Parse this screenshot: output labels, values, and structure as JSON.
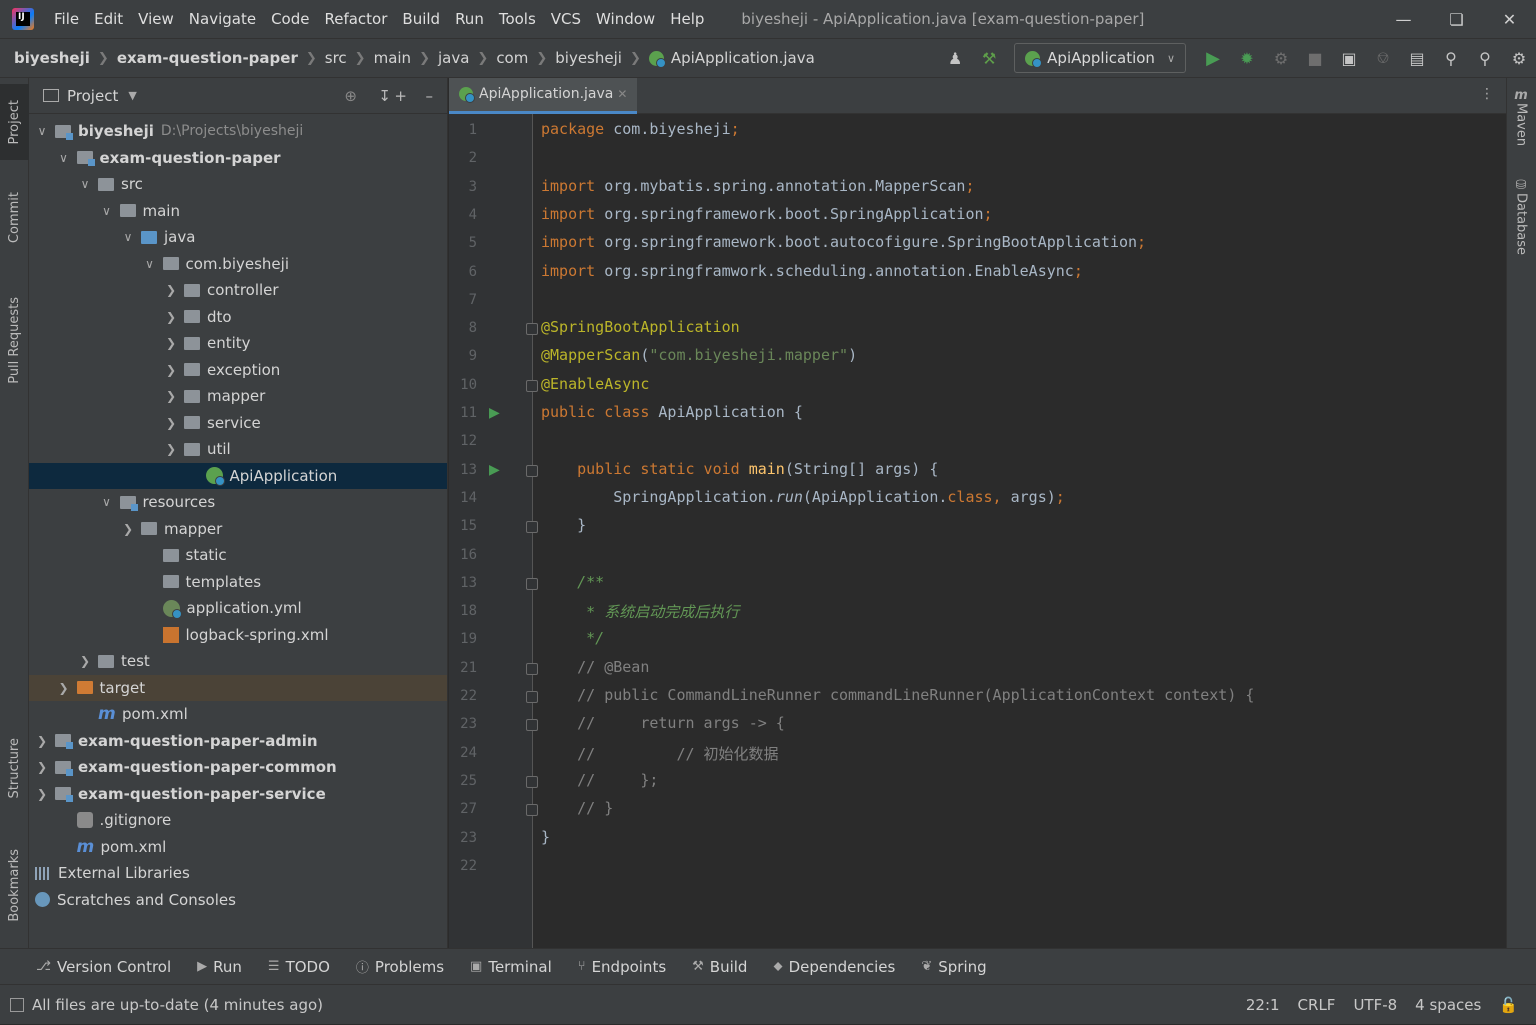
{
  "titlebar": {
    "menu": [
      "File",
      "Edit",
      "View",
      "Navigate",
      "Code",
      "Refactor",
      "Build",
      "Run",
      "Tools",
      "VCS",
      "Window",
      "Help"
    ],
    "window_title": "biyesheji - ApiApplication.java [exam-question-paper]"
  },
  "breadcrumb": [
    "biyesheji",
    "exam-question-paper",
    "src",
    "main",
    "java",
    "com",
    "biyesheji",
    "ApiApplication.java"
  ],
  "run_config": "ApiApplication",
  "left_stripe": [
    "Project",
    "Commit",
    "Pull Requests",
    "Structure",
    "Bookmarks"
  ],
  "right_stripe": [
    "Maven",
    "Database"
  ],
  "project": {
    "title": "Project",
    "root_path": "D:\\Projects\\biyesheji",
    "tree": [
      {
        "label": "biyesheji",
        "depth": 0,
        "icon": "module-folder",
        "chev": "down",
        "bold": true
      },
      {
        "label": "exam-question-paper",
        "depth": 1,
        "icon": "module-folder",
        "chev": "down",
        "bold": true
      },
      {
        "label": "src",
        "depth": 2,
        "icon": "folder",
        "chev": "down"
      },
      {
        "label": "main",
        "depth": 3,
        "icon": "folder",
        "chev": "down"
      },
      {
        "label": "java",
        "depth": 4,
        "icon": "source-folder",
        "chev": "down"
      },
      {
        "label": "com.biyesheji",
        "depth": 5,
        "icon": "package-folder",
        "chev": "down"
      },
      {
        "label": "controller",
        "depth": 6,
        "icon": "package-folder",
        "chev": "right"
      },
      {
        "label": "dto",
        "depth": 6,
        "icon": "package-folder",
        "chev": "right"
      },
      {
        "label": "entity",
        "depth": 6,
        "icon": "package-folder",
        "chev": "right"
      },
      {
        "label": "exception",
        "depth": 6,
        "icon": "package-folder",
        "chev": "right"
      },
      {
        "label": "mapper",
        "depth": 6,
        "icon": "package-folder",
        "chev": "right"
      },
      {
        "label": "service",
        "depth": 6,
        "icon": "package-folder",
        "chev": "right"
      },
      {
        "label": "util",
        "depth": 6,
        "icon": "package-folder",
        "chev": "right"
      },
      {
        "label": "ApiApplication",
        "depth": 7,
        "icon": "spring-class",
        "chev": "none",
        "selected": true
      },
      {
        "label": "resources",
        "depth": 3,
        "icon": "resources-folder",
        "chev": "down"
      },
      {
        "label": "mapper",
        "depth": 4,
        "icon": "folder",
        "chev": "right"
      },
      {
        "label": "static",
        "depth": 5,
        "icon": "folder",
        "chev": "none"
      },
      {
        "label": "templates",
        "depth": 5,
        "icon": "folder",
        "chev": "none"
      },
      {
        "label": "application.yml",
        "depth": 5,
        "icon": "yml-file",
        "chev": "none"
      },
      {
        "label": "logback-spring.xml",
        "depth": 5,
        "icon": "xml-file",
        "chev": "none"
      },
      {
        "label": "test",
        "depth": 2,
        "icon": "folder",
        "chev": "right"
      },
      {
        "label": "target",
        "depth": 1,
        "icon": "excluded-folder",
        "chev": "right",
        "highlight": true
      },
      {
        "label": "pom.xml",
        "depth": 2,
        "icon": "maven-file",
        "chev": "none"
      },
      {
        "label": "exam-question-paper-admin",
        "depth": 0,
        "icon": "module-folder",
        "chev": "right",
        "bold": true
      },
      {
        "label": "exam-question-paper-common",
        "depth": 0,
        "icon": "module-folder",
        "chev": "right",
        "bold": true
      },
      {
        "label": "exam-question-paper-service",
        "depth": 0,
        "icon": "module-folder",
        "chev": "right",
        "bold": true
      },
      {
        "label": ".gitignore",
        "depth": 1,
        "icon": "gitignore-file",
        "chev": "none"
      },
      {
        "label": "pom.xml",
        "depth": 1,
        "icon": "maven-file",
        "chev": "none"
      },
      {
        "label": "External Libraries",
        "depth": 0,
        "icon": "libraries",
        "chev": "none",
        "noindent": true
      },
      {
        "label": "Scratches and Consoles",
        "depth": 0,
        "icon": "scratches",
        "chev": "none",
        "noindent": true
      }
    ]
  },
  "editor": {
    "tab": "ApiApplication.java",
    "lines": [
      {
        "n": "1",
        "html": "<span class=\"kw\">package</span> com.biyesheji<span class=\"kw\">;</span>"
      },
      {
        "n": "2",
        "html": ""
      },
      {
        "n": "3",
        "html": "<span class=\"kw\">import</span> org.mybatis.spring.annotation.MapperScan<span class=\"kw\">;</span>"
      },
      {
        "n": "4",
        "html": "<span class=\"kw\">import</span> org.springframework.boot.SpringApplication<span class=\"kw\">;</span>"
      },
      {
        "n": "5",
        "html": "<span class=\"kw\">import</span> org.springframework.boot.autocofigure.SpringBootApplication<span class=\"kw\">;</span>"
      },
      {
        "n": "6",
        "html": "<span class=\"kw\">import</span> org.springframwork.scheduling.annotation.EnableAsync<span class=\"kw\">;</span>"
      },
      {
        "n": "7",
        "html": ""
      },
      {
        "n": "8",
        "html": "<span class=\"an\">@SpringBootApplication</span>",
        "fold": true
      },
      {
        "n": "9",
        "html": "<span class=\"an\">@MapperScan</span>(<span class=\"str\">\"com.biyesheji.mapper\"</span>)"
      },
      {
        "n": "10",
        "html": "<span class=\"an\">@EnableAsync</span>",
        "fold": true
      },
      {
        "n": "11",
        "html": "<span class=\"kw\">public class</span> ApiApplication {",
        "run": true
      },
      {
        "n": "12",
        "html": ""
      },
      {
        "n": "13",
        "html": "    <span class=\"kw\">public static void</span> <span class=\"mth\">main</span>(String[] args) {",
        "run": true,
        "fold": true
      },
      {
        "n": "14",
        "html": "        SpringApplication.<span class=\"it\">run</span>(ApiApplication.<span class=\"kw\">class, </span>args)<span class=\"kw\">;</span>"
      },
      {
        "n": "15",
        "html": "    }",
        "fold": true
      },
      {
        "n": "16",
        "html": ""
      },
      {
        "n": "13",
        "html": "    <span class=\"doc it\">/**</span>",
        "fold": true
      },
      {
        "n": "18",
        "html": "    <span class=\"doc it\"> * 系统启动完成后执行</span>"
      },
      {
        "n": "19",
        "html": "    <span class=\"doc it\"> */</span>"
      },
      {
        "n": "21",
        "html": "    <span class=\"cm\">// @Bean</span>",
        "fold": true
      },
      {
        "n": "22",
        "html": "    <span class=\"cm\">// public CommandLineRunner commandLineRunner(ApplicationContext context) {</span>",
        "fold": true
      },
      {
        "n": "23",
        "html": "    <span class=\"cm\">//     return args -> {</span>",
        "fold": true
      },
      {
        "n": "24",
        "html": "    <span class=\"cm\">//         // 初始化数据</span>"
      },
      {
        "n": "25",
        "html": "    <span class=\"cm\">//     };</span>",
        "fold": true
      },
      {
        "n": "27",
        "html": "    <span class=\"cm\">// }</span>",
        "fold": true
      },
      {
        "n": "23",
        "html": "}"
      },
      {
        "n": "22",
        "html": ""
      }
    ]
  },
  "bottom_tabs": [
    "Version Control",
    "Run",
    "TODO",
    "Problems",
    "Terminal",
    "Endpoints",
    "Build",
    "Dependencies",
    "Spring"
  ],
  "status": {
    "message": "All files are up-to-date (4 minutes ago)",
    "position": "22:1",
    "line_sep": "CRLF",
    "encoding": "UTF-8",
    "indent": "4 spaces"
  }
}
